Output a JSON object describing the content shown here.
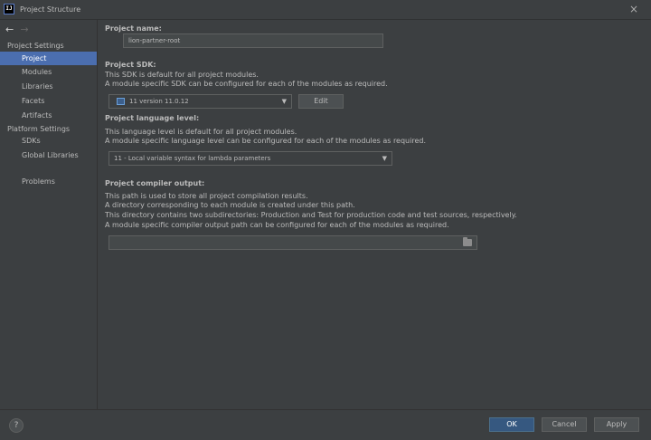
{
  "window": {
    "title": "Project Structure",
    "app_icon_text": "IJ",
    "close_glyph": "×"
  },
  "sidebar": {
    "back_glyph": "←",
    "forward_glyph": "→",
    "project_settings_header": "Project Settings",
    "project_items": [
      "Project",
      "Modules",
      "Libraries",
      "Facets",
      "Artifacts"
    ],
    "selected_item": "Project",
    "platform_settings_header": "Platform Settings",
    "platform_items": [
      "SDKs",
      "Global Libraries"
    ],
    "problems": "Problems"
  },
  "content": {
    "name_label": "Project name:",
    "name_value": "lion-partner-root",
    "sdk_label": "Project SDK:",
    "sdk_desc_1": "This SDK is default for all project modules.",
    "sdk_desc_2": "A module specific SDK can be configured for each of the modules as required.",
    "sdk_value": "11 version 11.0.12",
    "edit_button": "Edit",
    "lang_label": "Project language level:",
    "lang_desc_1": "This language level is default for all project modules.",
    "lang_desc_2": "A module specific language level can be configured for each of the modules as required.",
    "lang_value": "11 - Local variable syntax for lambda parameters",
    "output_label": "Project compiler output:",
    "output_desc_1": "This path is used to store all project compilation results.",
    "output_desc_2": "A directory corresponding to each module is created under this path.",
    "output_desc_3": "This directory contains two subdirectories: Production and Test for production code and test sources, respectively.",
    "output_desc_4": "A module specific compiler output path can be configured for each of the modules as required.",
    "output_value": "",
    "dropdown_glyph": "▼"
  },
  "footer": {
    "help_glyph": "?",
    "ok": "OK",
    "cancel": "Cancel",
    "apply": "Apply"
  },
  "colors": {
    "background": "#3c3f41",
    "selection": "#4b6eaf",
    "primary_button": "#365880"
  }
}
